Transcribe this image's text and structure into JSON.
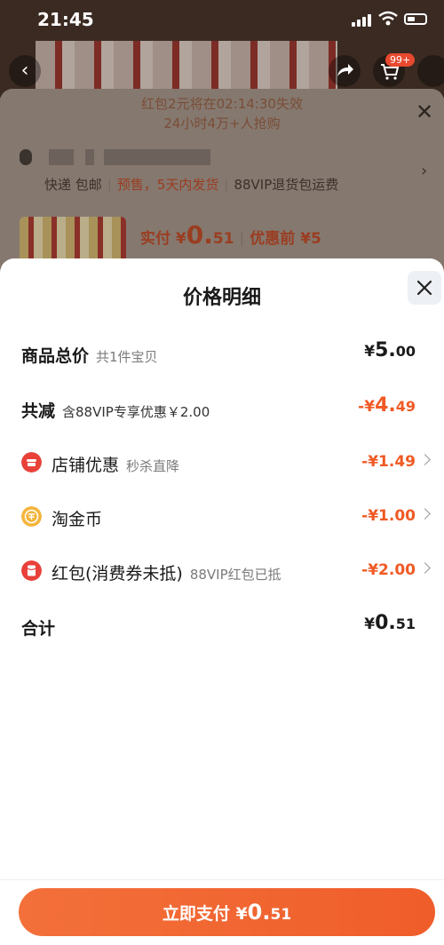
{
  "status_bar": {
    "time": "21:45"
  },
  "product_nav": {
    "cart_badge": "99+"
  },
  "background_sheet": {
    "banner_line1": "红包2元将在02:14:30失效",
    "banner_line2": "24小时4万+人抢购",
    "shipping": "快递 包邮",
    "presale": "预售，5天内发货",
    "vip_return": "88VIP退货包运费",
    "price_prefix": "实付 ¥",
    "price_int": "0.",
    "price_dec": "51",
    "before_discount": "优惠前 ¥5"
  },
  "price_detail": {
    "title": "价格明细",
    "rows": [
      {
        "label": "商品总价",
        "sub": "共1件宝贝",
        "currency": "¥",
        "int": "5.",
        "dec": "00"
      },
      {
        "label": "共减",
        "sub": "含88VIP专享优惠￥2.00",
        "currency": "-¥",
        "int": "4.",
        "dec": "49"
      },
      {
        "label": "店铺优惠",
        "sub": "秒杀直降",
        "value": "-¥1.49",
        "icon": "shop-icon",
        "icon_color": "#e8413a"
      },
      {
        "label": "淘金币",
        "sub": "",
        "value": "-¥1.00",
        "icon": "coin-icon",
        "icon_color": "#f4b53c"
      },
      {
        "label": "红包(消费券未抵)",
        "sub": "88VIP红包已抵",
        "value": "-¥2.00",
        "icon": "red-packet-icon",
        "icon_color": "#e8413a"
      },
      {
        "label": "合计",
        "sub": "",
        "currency": "¥",
        "int": "0.",
        "dec": "51"
      }
    ]
  },
  "pay_button": {
    "label": "立即支付 ¥",
    "int": "0.",
    "dec": "51"
  },
  "colors": {
    "accent": "#f05a24",
    "pay_button": "#f06430"
  }
}
